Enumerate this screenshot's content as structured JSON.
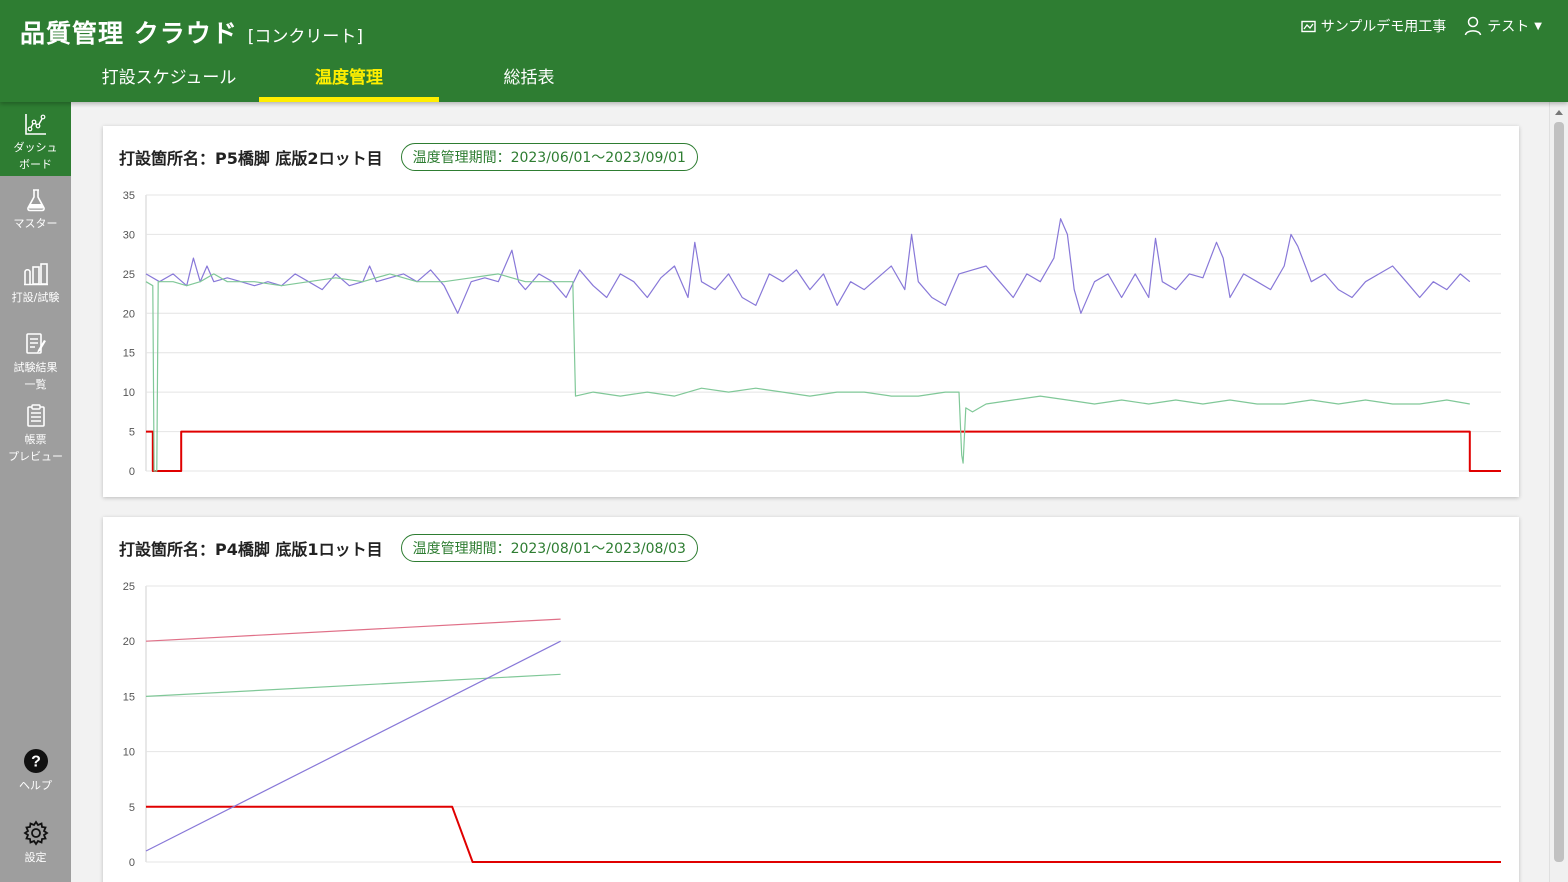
{
  "app": {
    "title": "品質管理 クラウド",
    "subtitle": "[コンクリート]"
  },
  "header": {
    "project": "サンプルデモ用工事",
    "user": "テスト"
  },
  "tabs": [
    {
      "label": "打設スケジュール",
      "active": false
    },
    {
      "label": "温度管理",
      "active": true
    },
    {
      "label": "総括表",
      "active": false
    }
  ],
  "sidebar": [
    {
      "label": "ダッシュ\nボード",
      "icon": "dashboard-icon",
      "active": true
    },
    {
      "label": "マスター",
      "icon": "flask-icon",
      "active": false
    },
    {
      "label": "打設/試験",
      "icon": "pour-test-icon",
      "active": false
    },
    {
      "label": "試験結果\n一覧",
      "icon": "results-list-icon",
      "active": false
    },
    {
      "label": "帳票\nプレビュー",
      "icon": "report-preview-icon",
      "active": false
    },
    {
      "label": "ヘルプ",
      "icon": "help-icon",
      "active": false
    },
    {
      "label": "設定",
      "icon": "gear-icon",
      "active": false
    }
  ],
  "colors": {
    "brand": "#2e7d32",
    "accent": "#ffee00",
    "sidebar": "#9e9e9e",
    "series_red": "#e00000",
    "series_purple": "#8878d8",
    "series_green": "#80c898",
    "series_pink": "#e07088"
  },
  "cards": [
    {
      "title": "打設箇所名：P5橋脚 底版2ロット目",
      "period": "温度管理期間：2023/06/01〜2023/09/01"
    },
    {
      "title": "打設箇所名：P4橋脚 底版1ロット目",
      "period": "温度管理期間：2023/08/01〜2023/08/03"
    }
  ],
  "chart_data": [
    {
      "type": "line",
      "ylim": [
        0,
        35
      ],
      "yticks": [
        "0",
        "5",
        "10",
        "15",
        "20",
        "25",
        "30",
        "35"
      ],
      "xlim": [
        0,
        100
      ],
      "grid": true,
      "series": [
        {
          "color": "#e00000",
          "points": [
            [
              0,
              5
            ],
            [
              0.5,
              5
            ],
            [
              0.5,
              0
            ],
            [
              2.6,
              0
            ],
            [
              2.6,
              5
            ],
            [
              97.7,
              5
            ],
            [
              97.7,
              0
            ],
            [
              100,
              0
            ]
          ]
        },
        {
          "color": "#8878d8",
          "points": [
            [
              0,
              25
            ],
            [
              1,
              24
            ],
            [
              2,
              25
            ],
            [
              3,
              23.5
            ],
            [
              3.5,
              27
            ],
            [
              4,
              24
            ],
            [
              4.5,
              26
            ],
            [
              5,
              24
            ],
            [
              6,
              24.5
            ],
            [
              7,
              24
            ],
            [
              8,
              23.5
            ],
            [
              9,
              24
            ],
            [
              10,
              23.5
            ],
            [
              11,
              25
            ],
            [
              12,
              24
            ],
            [
              13,
              23
            ],
            [
              14,
              25
            ],
            [
              15,
              23.5
            ],
            [
              16,
              24
            ],
            [
              16.5,
              26
            ],
            [
              17,
              24
            ],
            [
              18,
              24.5
            ],
            [
              19,
              25
            ],
            [
              20,
              24
            ],
            [
              21,
              25.5
            ],
            [
              22,
              23.5
            ],
            [
              23,
              20
            ],
            [
              24,
              24
            ],
            [
              25,
              24.5
            ],
            [
              26,
              24
            ],
            [
              27,
              28
            ],
            [
              27.5,
              24
            ],
            [
              28,
              23
            ],
            [
              29,
              25
            ],
            [
              30,
              24
            ],
            [
              31,
              22
            ],
            [
              32,
              25.5
            ],
            [
              33,
              23.5
            ],
            [
              34,
              22
            ],
            [
              35,
              25
            ],
            [
              36,
              24
            ],
            [
              37,
              22
            ],
            [
              38,
              24.5
            ],
            [
              39,
              26
            ],
            [
              40,
              22
            ],
            [
              40.5,
              29
            ],
            [
              41,
              24
            ],
            [
              42,
              23
            ],
            [
              43,
              25
            ],
            [
              44,
              22
            ],
            [
              45,
              21
            ],
            [
              46,
              25
            ],
            [
              47,
              24
            ],
            [
              48,
              25.5
            ],
            [
              49,
              23
            ],
            [
              50,
              25
            ],
            [
              51,
              21
            ],
            [
              52,
              24
            ],
            [
              53,
              23
            ],
            [
              54,
              24.5
            ],
            [
              55,
              26
            ],
            [
              56,
              23
            ],
            [
              56.5,
              30
            ],
            [
              57,
              24
            ],
            [
              58,
              22
            ],
            [
              59,
              21
            ],
            [
              60,
              25
            ],
            [
              61,
              25.5
            ],
            [
              62,
              26
            ],
            [
              63,
              24
            ],
            [
              64,
              22
            ],
            [
              65,
              25
            ],
            [
              66,
              24
            ],
            [
              67,
              27
            ],
            [
              67.5,
              32
            ],
            [
              68,
              30
            ],
            [
              68.5,
              23
            ],
            [
              69,
              20
            ],
            [
              70,
              24
            ],
            [
              71,
              25
            ],
            [
              72,
              22
            ],
            [
              73,
              25
            ],
            [
              74,
              22
            ],
            [
              74.5,
              29.5
            ],
            [
              75,
              24
            ],
            [
              76,
              23
            ],
            [
              77,
              25
            ],
            [
              78,
              24.5
            ],
            [
              79,
              29
            ],
            [
              79.5,
              27
            ],
            [
              80,
              22
            ],
            [
              81,
              25
            ],
            [
              82,
              24
            ],
            [
              83,
              23
            ],
            [
              84,
              26
            ],
            [
              84.5,
              30
            ],
            [
              85,
              28.5
            ],
            [
              86,
              24
            ],
            [
              87,
              25
            ],
            [
              88,
              23
            ],
            [
              89,
              22
            ],
            [
              90,
              24
            ],
            [
              91,
              25
            ],
            [
              92,
              26
            ],
            [
              93,
              24
            ],
            [
              94,
              22
            ],
            [
              95,
              24
            ],
            [
              96,
              23
            ],
            [
              97,
              25
            ],
            [
              97.7,
              24
            ]
          ]
        },
        {
          "color": "#80c898",
          "points": [
            [
              0,
              24
            ],
            [
              0.5,
              23.5
            ],
            [
              0.6,
              0
            ],
            [
              0.8,
              0
            ],
            [
              0.9,
              24
            ],
            [
              2,
              24
            ],
            [
              3,
              23.5
            ],
            [
              4,
              24
            ],
            [
              5,
              25
            ],
            [
              6,
              24
            ],
            [
              8,
              24
            ],
            [
              10,
              23.5
            ],
            [
              12,
              24
            ],
            [
              14,
              24.5
            ],
            [
              16,
              24
            ],
            [
              18,
              25
            ],
            [
              20,
              24
            ],
            [
              22,
              24
            ],
            [
              24,
              24.5
            ],
            [
              26,
              25
            ],
            [
              28,
              24
            ],
            [
              30,
              24
            ],
            [
              31.5,
              24
            ],
            [
              31.7,
              9.5
            ],
            [
              33,
              10
            ],
            [
              35,
              9.5
            ],
            [
              37,
              10
            ],
            [
              39,
              9.5
            ],
            [
              41,
              10.5
            ],
            [
              43,
              10
            ],
            [
              45,
              10.5
            ],
            [
              47,
              10
            ],
            [
              49,
              9.5
            ],
            [
              51,
              10
            ],
            [
              53,
              10
            ],
            [
              55,
              9.5
            ],
            [
              57,
              9.5
            ],
            [
              59,
              10
            ],
            [
              60,
              10
            ],
            [
              60.2,
              2
            ],
            [
              60.3,
              1
            ],
            [
              60.5,
              8
            ],
            [
              61,
              7.5
            ],
            [
              62,
              8.5
            ],
            [
              64,
              9
            ],
            [
              66,
              9.5
            ],
            [
              68,
              9
            ],
            [
              70,
              8.5
            ],
            [
              72,
              9
            ],
            [
              74,
              8.5
            ],
            [
              76,
              9
            ],
            [
              78,
              8.5
            ],
            [
              80,
              9
            ],
            [
              82,
              8.5
            ],
            [
              84,
              8.5
            ],
            [
              86,
              9
            ],
            [
              88,
              8.5
            ],
            [
              90,
              9
            ],
            [
              92,
              8.5
            ],
            [
              94,
              8.5
            ],
            [
              96,
              9
            ],
            [
              97.7,
              8.5
            ]
          ]
        }
      ]
    },
    {
      "type": "line",
      "ylim": [
        0,
        25
      ],
      "yticks": [
        "0",
        "5",
        "10",
        "15",
        "20",
        "25"
      ],
      "xlim": [
        0,
        100
      ],
      "grid": true,
      "series": [
        {
          "color": "#e00000",
          "points": [
            [
              0,
              5
            ],
            [
              22.6,
              5
            ],
            [
              24.1,
              0
            ],
            [
              100,
              0
            ]
          ]
        },
        {
          "color": "#e07088",
          "points": [
            [
              0,
              20
            ],
            [
              30.6,
              22
            ]
          ]
        },
        {
          "color": "#80c898",
          "points": [
            [
              0,
              15
            ],
            [
              30.6,
              17
            ]
          ]
        },
        {
          "color": "#8878d8",
          "points": [
            [
              0,
              1
            ],
            [
              30.6,
              20
            ]
          ]
        }
      ]
    }
  ]
}
